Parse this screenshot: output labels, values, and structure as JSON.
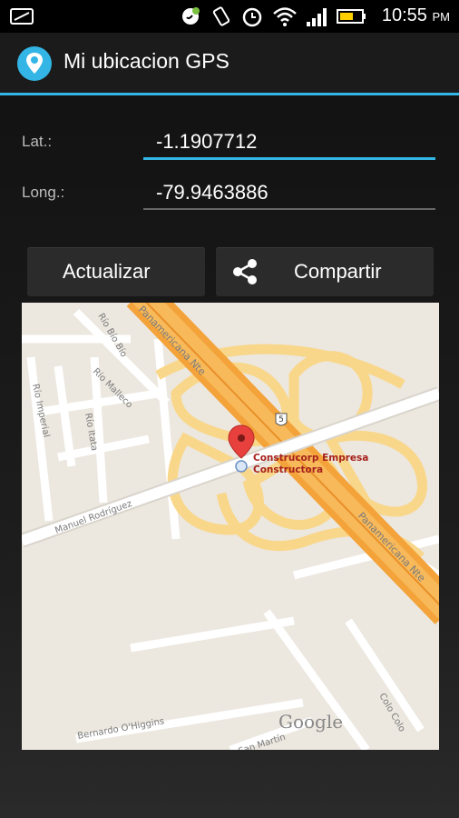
{
  "status_bar": {
    "time": "10:55",
    "ampm": "PM"
  },
  "action_bar": {
    "title": "Mi ubicacion GPS",
    "icon": "map-pin-icon",
    "accent": "#33b5e5"
  },
  "form": {
    "lat_label": "Lat.:",
    "lat_value": "-1.1907712",
    "long_label": "Long.:",
    "long_value": "-79.9463886"
  },
  "buttons": {
    "update_label": "Actualizar",
    "share_label": "Compartir",
    "share_icon": "share-icon"
  },
  "map": {
    "place_name_line1": "Construcorp Empresa",
    "place_name_line2": "Constructora",
    "route_shield": "5",
    "logo": "Google",
    "streets": {
      "panamericana_top": "Panamericana Nte",
      "panamericana_bottom": "Panamericana Nte",
      "rio_bio_bio": "Río Bío Bío",
      "rio_malleco": "Río Malleco",
      "rio_imperial": "Río Imperial",
      "rio_itata": "Río Itata",
      "manuel_rodriguez": "Manuel Rodríguez",
      "bernardo_ohiggins": "Bernardo O'Higgins",
      "san_martin": "San Martín",
      "colo_colo": "Colo Colo"
    }
  }
}
